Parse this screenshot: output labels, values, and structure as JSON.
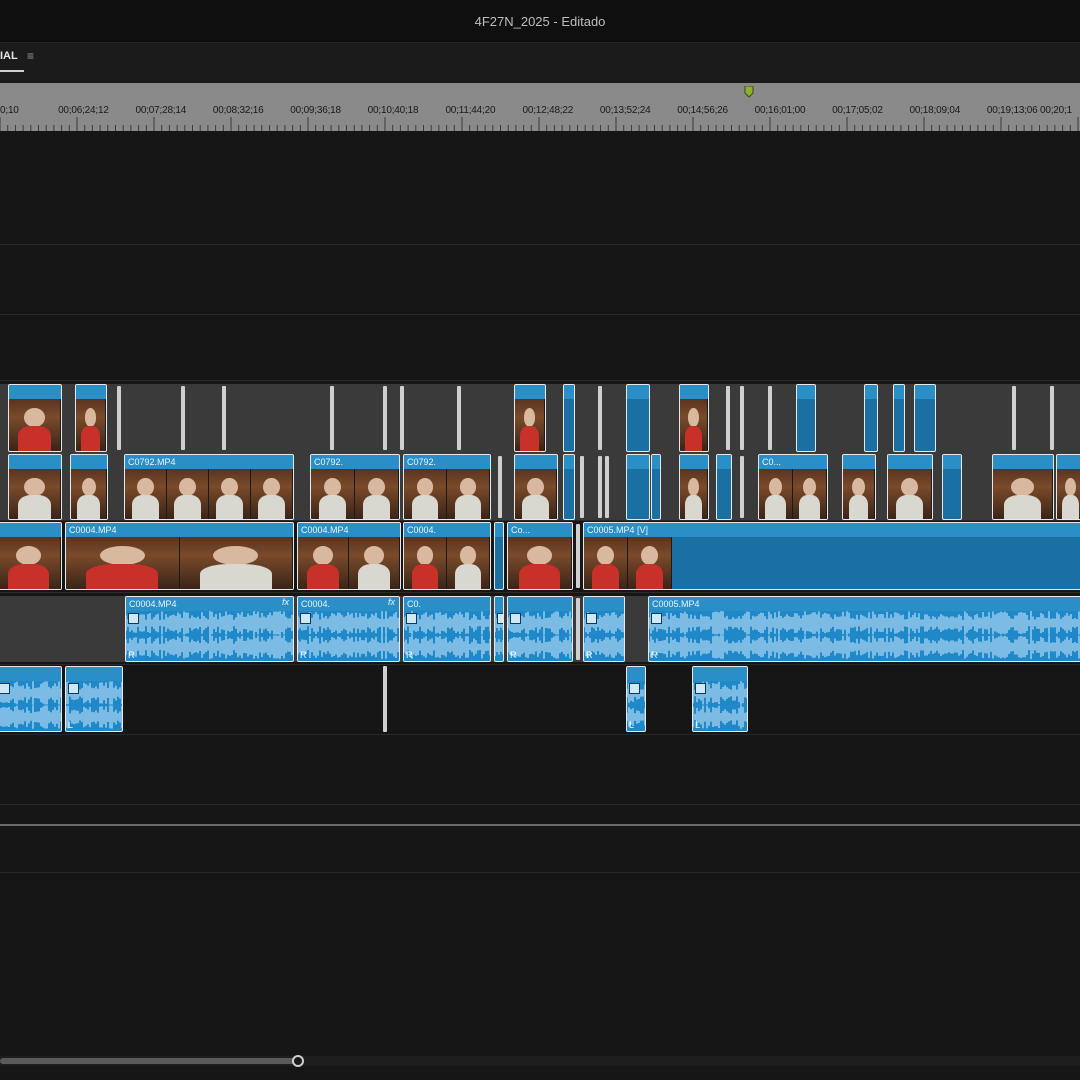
{
  "window": {
    "title": "4F27N_2025 - Editado"
  },
  "panel": {
    "tab_label": "IAL",
    "menu_icon": "hamburger-icon"
  },
  "ruler": {
    "timecodes": [
      "0;10",
      "00;06;24;12",
      "00;07;28;14",
      "00;08;32;16",
      "00;09;36;18",
      "00;10;40;18",
      "00;11;44;20",
      "00;12;48;22",
      "00;13;52;24",
      "00;14;56;26",
      "00;16;01;00",
      "00;17;05;02",
      "00;18;09;04",
      "00;19;13;06",
      "00;20;1"
    ]
  },
  "clips": {
    "v2_a": "C0792.MP4",
    "v2_b": "C0792.",
    "v2_c": "C0792.",
    "v2_d": "C0...",
    "v1_a": "C0004.MP4",
    "v1_b": "C0004.MP4",
    "v1_c": "C0004.",
    "v1_d": "Co...",
    "v1_e": "C0005.MP4 [V]",
    "a1_a": "C0004.MP4",
    "a1_b": "C0004.",
    "a1_c": "C0.",
    "a1_e": "C0005.MP4"
  },
  "audio_labels": {
    "right": "R",
    "left": "L",
    "fx": "fx"
  },
  "colors": {
    "clip_blue": "#1a74a8",
    "audio_blue": "#1e88c8",
    "playhead": "#8fb030"
  }
}
